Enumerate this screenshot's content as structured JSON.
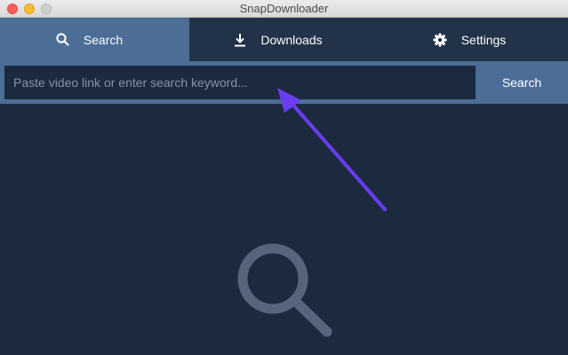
{
  "window": {
    "title": "SnapDownloader"
  },
  "tabs": [
    {
      "label": "Search",
      "icon": "search-icon",
      "active": true
    },
    {
      "label": "Downloads",
      "icon": "download-icon",
      "active": false
    },
    {
      "label": "Settings",
      "icon": "gear-icon",
      "active": false
    }
  ],
  "search": {
    "placeholder": "Paste video link or enter search keyword...",
    "value": "",
    "button_label": "Search"
  },
  "colors": {
    "background": "#1c2a40",
    "tab_bar": "#223248",
    "accent": "#4b6d96",
    "annotation_arrow": "#6a3df0"
  },
  "empty_state": {
    "icon": "search-icon"
  },
  "annotation": {
    "icon": "arrow-annotation"
  }
}
